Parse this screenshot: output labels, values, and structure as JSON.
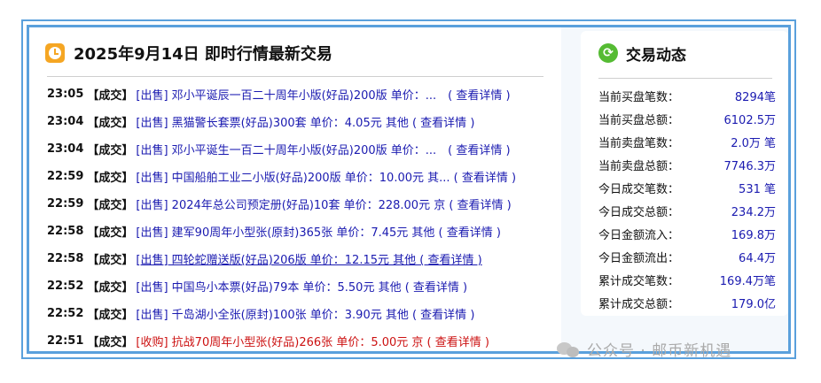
{
  "left_panel": {
    "title": "2025年9月14日 即时行情最新交易",
    "trades": [
      {
        "time": "23:05",
        "deal": "【成交】",
        "text": "[出售] 邓小平诞辰一百二十周年小版(好品)200版 单价：...　( 查看详情 )"
      },
      {
        "time": "23:04",
        "deal": "【成交】",
        "text": "[出售] 黑猫警长套票(好品)300套 单价：4.05元 其他 ( 查看详情 )"
      },
      {
        "time": "23:04",
        "deal": "【成交】",
        "text": "[出售] 邓小平诞生一百二十周年小版(好品)200版 单价：...　( 查看详情 )"
      },
      {
        "time": "22:59",
        "deal": "【成交】",
        "text": "[出售] 中国船舶工业二小版(好品)200版 单价：10.00元 其... ( 查看详情 )"
      },
      {
        "time": "22:59",
        "deal": "【成交】",
        "text": "[出售] 2024年总公司预定册(好品)10套 单价：228.00元 京 ( 查看详情 )"
      },
      {
        "time": "22:58",
        "deal": "【成交】",
        "text": "[出售] 建军90周年小型张(原封)365张 单价：7.45元 其他 ( 查看详情 )"
      },
      {
        "time": "22:58",
        "deal": "【成交】",
        "text": "[出售] 四轮蛇赠送版(好品)206版 单价：12.15元 其他 ( 查看详情 )"
      },
      {
        "time": "22:52",
        "deal": "【成交】",
        "text": "[出售] 中国鸟小本票(好品)79本 单价：5.50元 其他 ( 查看详情 )"
      },
      {
        "time": "22:52",
        "deal": "【成交】",
        "text": "[出售] 千岛湖小全张(原封)100张 单价：3.90元 其他 ( 查看详情 )"
      },
      {
        "time": "22:51",
        "deal": "【成交】",
        "text": "[收购] 抗战70周年小型张(好品)266张 单价：5.00元 京 ( 查看详情 )"
      }
    ]
  },
  "right_panel": {
    "title": "交易动态",
    "stats": [
      {
        "label": "当前买盘笔数：",
        "value": "8294笔"
      },
      {
        "label": "当前买盘总额：",
        "value": "6102.5万"
      },
      {
        "label": "当前卖盘笔数：",
        "value": "2.0万 笔"
      },
      {
        "label": "当前卖盘总额：",
        "value": "7746.3万"
      },
      {
        "label": "今日成交笔数：",
        "value": "531 笔"
      },
      {
        "label": "今日成交总额：",
        "value": "234.2万"
      },
      {
        "label": "今日金额流入：",
        "value": "169.8万"
      },
      {
        "label": "今日金额流出：",
        "value": "64.4万"
      },
      {
        "label": "累计成交笔数：",
        "value": "169.4万笔"
      },
      {
        "label": "累计成交总额：",
        "value": "179.0亿"
      }
    ]
  },
  "watermark": {
    "text": "公众号 · 邮币新机遇"
  },
  "colors": {
    "border": "#5aa0dc",
    "link": "#1a1ab0",
    "buy_red": "#cc1111",
    "clock_orange": "#f5a623",
    "refresh_green": "#55bb33"
  }
}
